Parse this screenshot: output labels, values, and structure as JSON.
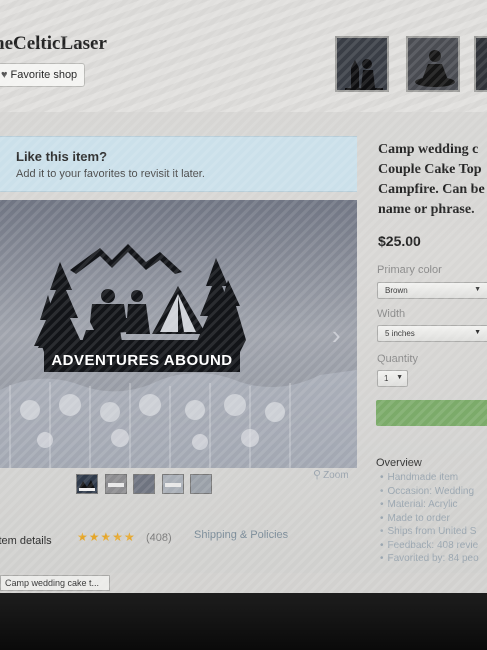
{
  "shop": {
    "name": "heCelticLaser",
    "favorite_label": "Favorite shop"
  },
  "favorite_prompt": {
    "title": "Like this item?",
    "subtitle": "Add it to your favorites to revisit it later."
  },
  "product_image": {
    "caption": "ADVENTURES ABOUND",
    "zoom_label": "Zoom",
    "thumbnails": [
      "mini-1",
      "mini-2",
      "mini-3",
      "mini-4",
      "mini-5"
    ]
  },
  "tabs": {
    "details": "item details",
    "stars": "★★★★★",
    "review_count": "(408)",
    "shipping": "Shipping & Policies"
  },
  "listing": {
    "title_lines": [
      "Camp wedding c",
      "Couple Cake Top",
      "Campfire. Can be",
      "name or phrase."
    ],
    "price": "$25.00",
    "primary_color_label": "Primary color",
    "primary_color_value": "Brown",
    "width_label": "Width",
    "width_value": "5 inches",
    "quantity_label": "Quantity",
    "quantity_value": "1"
  },
  "overview": {
    "title": "Overview",
    "items": [
      "Handmade item",
      "Occasion: Wedding",
      "Material: Acrylic",
      "Made to order",
      "Ships from United S",
      "Feedback: 408 revie",
      "Favorited by: 84 peo"
    ]
  },
  "status": {
    "tab_label": "Camp wedding cake t..."
  },
  "colors": {
    "like_box_bg": "#cbe0ea",
    "star": "#e5a629",
    "add_to_cart": "#7cab6a"
  }
}
